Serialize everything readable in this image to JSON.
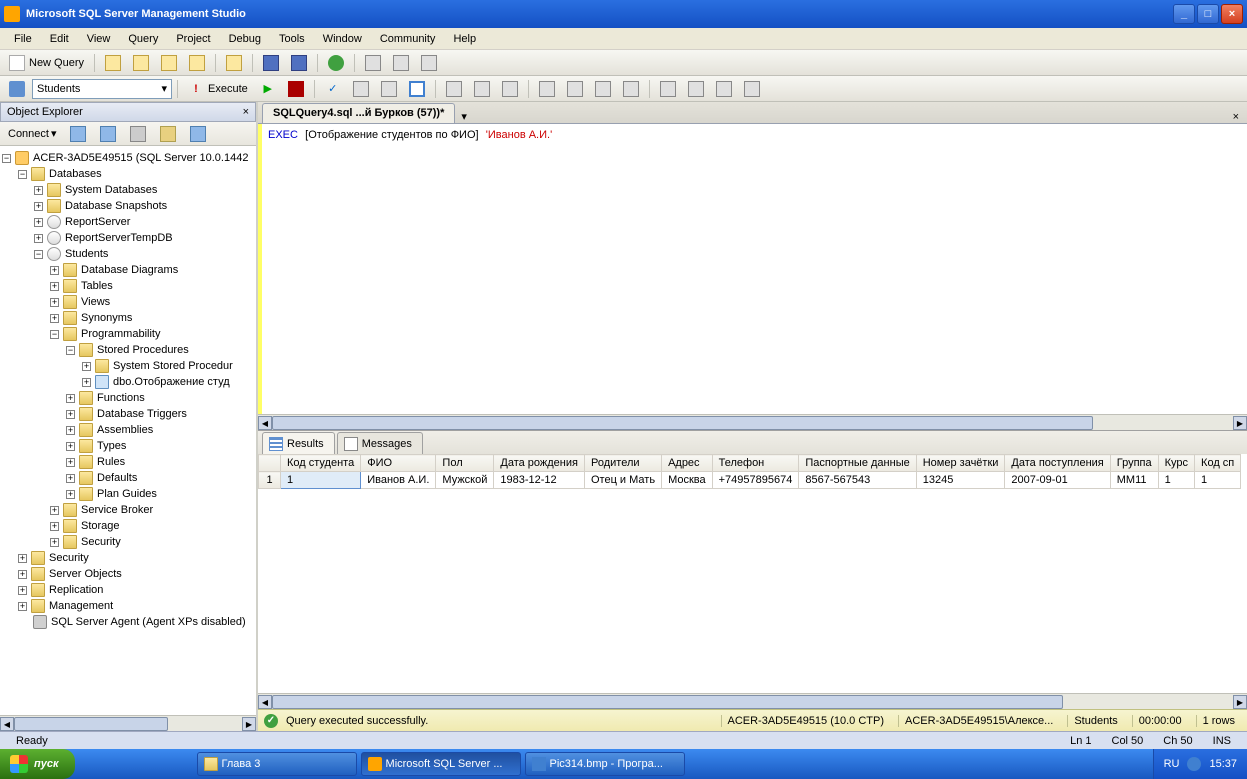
{
  "titlebar": {
    "title": "Microsoft SQL Server Management Studio"
  },
  "menu": [
    "File",
    "Edit",
    "View",
    "Query",
    "Project",
    "Debug",
    "Tools",
    "Window",
    "Community",
    "Help"
  ],
  "toolbar1": {
    "new_query": "New Query"
  },
  "toolbar2": {
    "db_selected": "Students",
    "execute": "Execute"
  },
  "object_explorer": {
    "title": "Object Explorer",
    "connect": "Connect",
    "root": "ACER-3AD5E49515 (SQL Server 10.0.1442",
    "databases": "Databases",
    "sys_db": "System Databases",
    "db_snap": "Database Snapshots",
    "report_server": "ReportServer",
    "report_temp": "ReportServerTempDB",
    "students": "Students",
    "db_diag": "Database Diagrams",
    "tables": "Tables",
    "views": "Views",
    "synonyms": "Synonyms",
    "programmability": "Programmability",
    "stored_proc": "Stored Procedures",
    "sys_stored": "System Stored Procedur",
    "custom_proc": "dbo.Отображение студ",
    "functions": "Functions",
    "db_triggers": "Database Triggers",
    "assemblies": "Assemblies",
    "types": "Types",
    "rules": "Rules",
    "defaults": "Defaults",
    "plan_guides": "Plan Guides",
    "service_broker": "Service Broker",
    "storage": "Storage",
    "security_inner": "Security",
    "security": "Security",
    "server_objects": "Server Objects",
    "replication": "Replication",
    "management": "Management",
    "agent": "SQL Server Agent (Agent XPs disabled)"
  },
  "doc_tab": "SQLQuery4.sql ...й Бурков (57))*",
  "sql": {
    "kw": "EXEC",
    "proc": "[Отображение студентов по ФИО]",
    "arg": "'Иванов А.И.'"
  },
  "results": {
    "tab_results": "Results",
    "tab_messages": "Messages",
    "columns": [
      "Код студента",
      "ФИО",
      "Пол",
      "Дата рождения",
      "Родители",
      "Адрес",
      "Телефон",
      "Паспортные данные",
      "Номер зачётки",
      "Дата поступления",
      "Группа",
      "Курс",
      "Код сп"
    ],
    "row": [
      "1",
      "Иванов А.И.",
      "Мужской",
      "1983-12-12",
      "Отец и Мать",
      "Москва",
      "+74957895674",
      "8567-567543",
      "13245",
      "2007-09-01",
      "ММ11",
      "1",
      "1"
    ]
  },
  "qstatus": {
    "msg": "Query executed successfully.",
    "server": "ACER-3AD5E49515 (10.0 CTP)",
    "user": "ACER-3AD5E49515\\Алексе...",
    "db": "Students",
    "time": "00:00:00",
    "rows": "1 rows"
  },
  "statusbar": {
    "ready": "Ready",
    "ln": "Ln 1",
    "col": "Col 50",
    "ch": "Ch 50",
    "ins": "INS"
  },
  "taskbar": {
    "start": "пуск",
    "items": [
      "Глава 3",
      "Microsoft SQL Server ...",
      "Pic314.bmp - Програ..."
    ],
    "lang": "RU",
    "clock": "15:37"
  }
}
